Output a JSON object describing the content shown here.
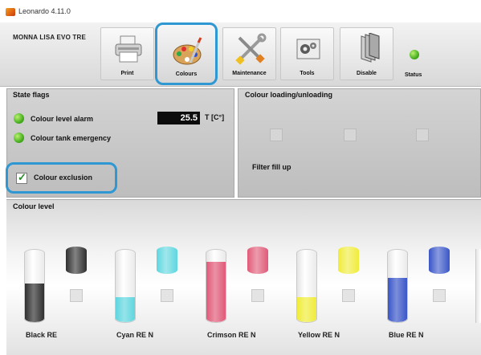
{
  "window": {
    "title": "Leonardo 4.11.0"
  },
  "toolbar": {
    "machine_name": "MONNA LISA EVO TRE",
    "buttons": [
      {
        "label": "Print",
        "icon": "printer-icon",
        "selected": false
      },
      {
        "label": "Colours",
        "icon": "palette-icon",
        "selected": true
      },
      {
        "label": "Maintenance",
        "icon": "tools-icon",
        "selected": false
      },
      {
        "label": "Tools",
        "icon": "gears-icon",
        "selected": false
      },
      {
        "label": "Disable",
        "icon": "disable-icon",
        "selected": false
      }
    ],
    "status_label": "Status",
    "status_color": "#48b020"
  },
  "state_flags": {
    "title": "State flags",
    "flags": [
      {
        "label": "Colour level alarm",
        "state_color": "#48b020"
      },
      {
        "label": "Colour tank emergency",
        "state_color": "#48b020"
      }
    ],
    "temperature": {
      "value": "25.5",
      "unit": "T [C°]"
    },
    "exclusion": {
      "label": "Colour exclusion",
      "checked": true
    }
  },
  "loading": {
    "title": "Colour loading/unloading",
    "filter_label": "Filter fill up"
  },
  "colour_level": {
    "title": "Colour level",
    "inks": [
      {
        "label": "Black RE",
        "color": "#2f2f2f",
        "level": 0.55
      },
      {
        "label": "Cyan RE N",
        "color": "#5fd6df",
        "level": 0.35
      },
      {
        "label": "Crimson RE N",
        "color": "#e05a78",
        "level": 0.85
      },
      {
        "label": "Yellow RE N",
        "color": "#f0ec3a",
        "level": 0.35
      },
      {
        "label": "Blue RE N",
        "color": "#3a56c8",
        "level": 0.62
      }
    ]
  },
  "accent_color": "#2f97d2"
}
